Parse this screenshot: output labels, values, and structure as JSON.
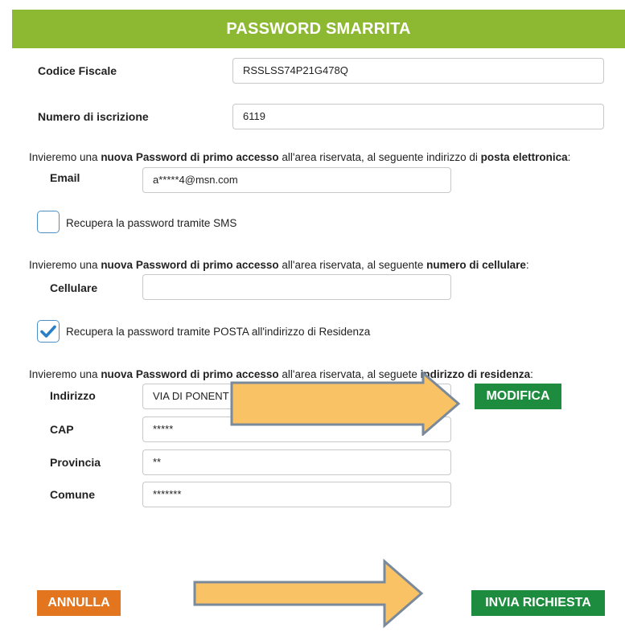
{
  "header": {
    "title": "PASSWORD SMARRITA"
  },
  "form": {
    "codice_fiscale": {
      "label": "Codice Fiscale",
      "value": "RSSLSS74P21G478Q"
    },
    "numero_iscrizione": {
      "label": "Numero di iscrizione",
      "value": "6119"
    },
    "email_info": {
      "p1": "Invieremo una ",
      "b1": "nuova",
      "p2": " ",
      "b2": "Password di primo accesso",
      "p3": " all'area riservata, al seguente indirizzo di ",
      "b3": "posta elettronica",
      "p4": ":"
    },
    "email": {
      "label": "Email",
      "value": "a*****4@msn.com"
    },
    "sms_option": {
      "label": "Recupera la password tramite SMS",
      "checked": false
    },
    "cell_info": {
      "p1": "Invieremo una ",
      "b1": "nuova",
      "p2": " ",
      "b2": "Password di primo accesso",
      "p3": " all'area riservata, al seguente ",
      "b3": "numero di cellulare",
      "p4": ":"
    },
    "cellulare": {
      "label": "Cellulare",
      "value": ""
    },
    "posta_option": {
      "label": "Recupera la password tramite POSTA all'indirizzo di Residenza",
      "checked": true
    },
    "res_info": {
      "p1": "Invieremo una ",
      "b1": "nuova",
      "p2": " ",
      "b2": "Password di primo accesso",
      "p3": " all'area riservata, al segue",
      "p3b": "te ",
      "b3": "indirizzo di residenza",
      "p4": ":"
    },
    "indirizzo": {
      "label": "Indirizzo",
      "value": "VIA DI PONENT"
    },
    "cap": {
      "label": "CAP",
      "value": "*****"
    },
    "provincia": {
      "label": "Provincia",
      "value": "**"
    },
    "comune": {
      "label": "Comune",
      "value": "*******"
    }
  },
  "buttons": {
    "modifica": "MODIFICA",
    "annulla": "ANNULLA",
    "invia": "INVIA RICHIESTA"
  },
  "colors": {
    "header_green": "#8cb832",
    "button_green": "#1e8c3e",
    "button_orange": "#e2751e",
    "arrow_fill": "#f9c365",
    "arrow_stroke": "#7a8a9a",
    "checkbox_blue": "#4a90c8"
  },
  "icons": {
    "checkmark": "checkmark-icon",
    "annotation_arrow": "right-arrow-icon"
  }
}
